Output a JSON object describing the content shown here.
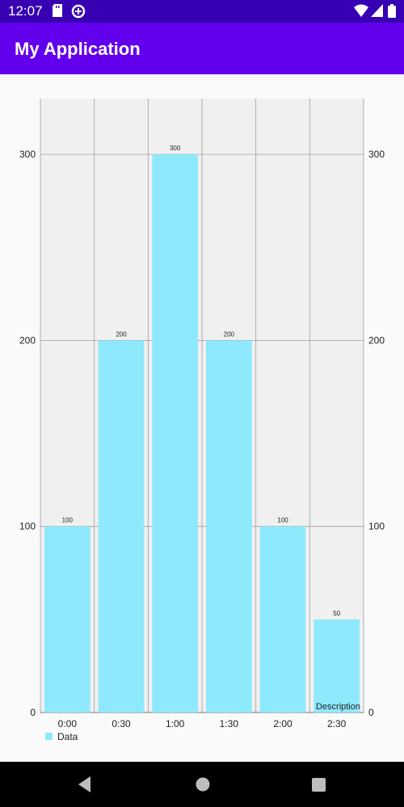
{
  "status_bar": {
    "time": "12:07",
    "icons": [
      "sd-card-icon",
      "data-saver-icon",
      "wifi-icon",
      "signal-icon",
      "battery-icon"
    ]
  },
  "app_bar": {
    "title": "My Application"
  },
  "chart_data": {
    "type": "bar",
    "categories": [
      "0:00",
      "0:30",
      "1:00",
      "1:30",
      "2:00",
      "2:30"
    ],
    "series": [
      {
        "name": "Data",
        "values": [
          100,
          200,
          300,
          200,
          100,
          50
        ],
        "color": "#8ee9fc"
      }
    ],
    "value_labels": [
      "100",
      "200",
      "300",
      "200",
      "100",
      "50"
    ],
    "ylim": [
      0,
      330
    ],
    "y_ticks": [
      0,
      100,
      200,
      300
    ],
    "y_tick_labels": [
      "0",
      "100",
      "200",
      "300"
    ],
    "dual_y_axis": true,
    "grid": true,
    "plot_background": "#f0f0f0",
    "grid_color": "#9e9e9e",
    "legend": {
      "position": "bottom-left",
      "label": "Data"
    },
    "description": "Description",
    "title": "",
    "xlabel": "",
    "ylabel": ""
  },
  "nav_bar": {
    "buttons": [
      "back-icon",
      "home-icon",
      "recents-icon"
    ]
  }
}
